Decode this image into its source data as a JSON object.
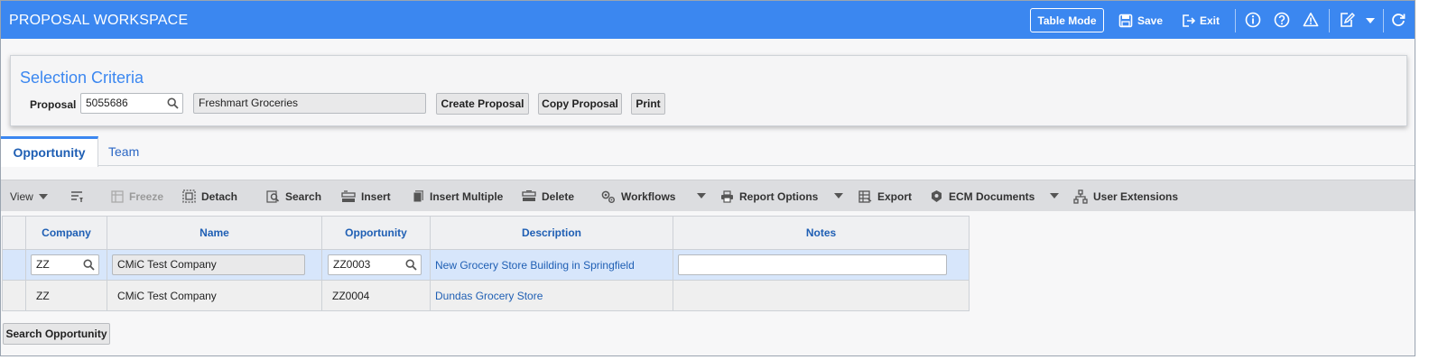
{
  "header": {
    "title": "PROPOSAL WORKSPACE",
    "table_mode_label": "Table Mode",
    "save_label": "Save",
    "exit_label": "Exit"
  },
  "criteria": {
    "title": "Selection Criteria",
    "proposal_label": "Proposal",
    "proposal_value": "5055686",
    "proposal_name": "Freshmart Groceries",
    "create_label": "Create Proposal",
    "copy_label": "Copy Proposal",
    "print_label": "Print"
  },
  "tabs": [
    {
      "label": "Opportunity",
      "active": true
    },
    {
      "label": "Team",
      "active": false
    }
  ],
  "toolbar": {
    "view": "View",
    "freeze": "Freeze",
    "detach": "Detach",
    "search": "Search",
    "insert": "Insert",
    "insert_multiple": "Insert Multiple",
    "delete": "Delete",
    "workflows": "Workflows",
    "report_options": "Report Options",
    "export": "Export",
    "ecm_documents": "ECM Documents",
    "user_extensions": "User Extensions"
  },
  "grid": {
    "columns": [
      "Company",
      "Name",
      "Opportunity",
      "Description",
      "Notes"
    ],
    "rows": [
      {
        "company": "ZZ",
        "name": "CMiC Test Company",
        "opportunity": "ZZ0003",
        "description": "New Grocery Store Building in Springfield",
        "notes": ""
      },
      {
        "company": "ZZ",
        "name": "CMiC Test Company",
        "opportunity": "ZZ0004",
        "description": "Dundas Grocery Store",
        "notes": ""
      }
    ]
  },
  "footer": {
    "search_opportunity_label": "Search Opportunity"
  },
  "colors": {
    "header_bg": "#3b87f0",
    "accent_text": "#1f5fb4",
    "selected_row": "#d7e6fb"
  }
}
